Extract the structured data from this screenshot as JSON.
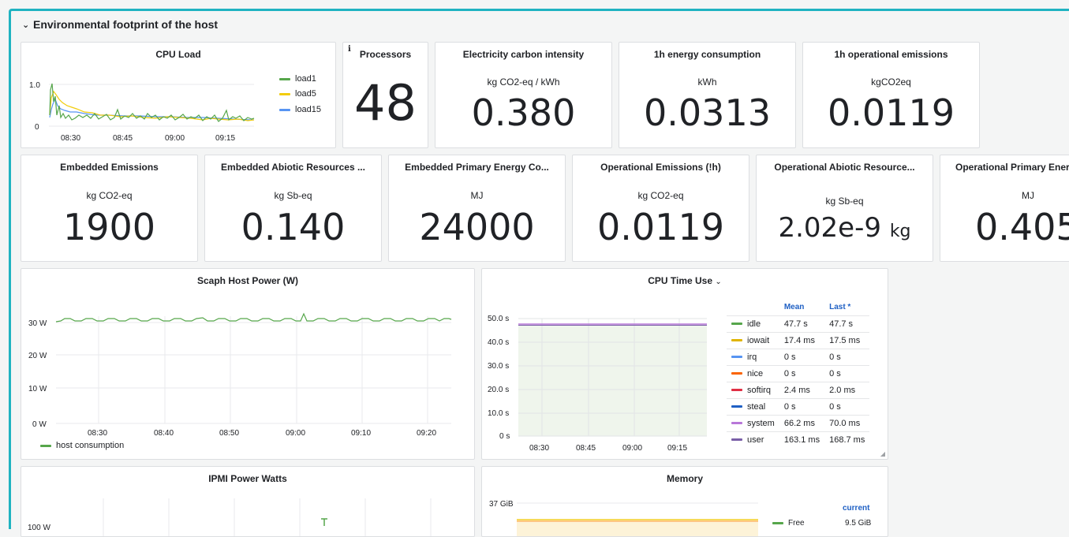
{
  "row": {
    "title": "Environmental footprint of the host"
  },
  "cpu_load": {
    "title": "CPU Load",
    "y_ticks": [
      "1.0",
      "0"
    ],
    "x_ticks": [
      "08:30",
      "08:45",
      "09:00",
      "09:15"
    ],
    "legend": [
      {
        "label": "load1",
        "color": "#56a64b"
      },
      {
        "label": "load5",
        "color": "#f2cc0c"
      },
      {
        "label": "load15",
        "color": "#5794f2"
      }
    ]
  },
  "processors": {
    "title": "Processors",
    "value": "48",
    "info": "i"
  },
  "carbon_intensity": {
    "title": "Electricity carbon intensity",
    "unit": "kg CO2-eq / kWh",
    "value": "0.380"
  },
  "energy_1h": {
    "title": "1h energy consumption",
    "unit": "kWh",
    "value": "0.0313"
  },
  "emissions_1h": {
    "title": "1h operational emissions",
    "unit": "kgCO2eq",
    "value": "0.0119"
  },
  "stats_row2": [
    {
      "title": "Embedded Emissions",
      "unit": "kg CO2-eq",
      "value": "1900",
      "suffix": ""
    },
    {
      "title": "Embedded Abiotic Resources ...",
      "unit": "kg Sb-eq",
      "value": "0.140",
      "suffix": ""
    },
    {
      "title": "Embedded Primary Energy Co...",
      "unit": "MJ",
      "value": "24000",
      "suffix": ""
    },
    {
      "title": "Operational Emissions (!h)",
      "unit": "kg CO2-eq",
      "value": "0.0119",
      "suffix": ""
    },
    {
      "title": "Operational Abiotic Resource...",
      "unit": "kg Sb-eq",
      "value": "2.02e-9",
      "suffix": "kg"
    },
    {
      "title": "Operational Primary Ener",
      "unit": "MJ",
      "value": "0.405",
      "suffix": ""
    }
  ],
  "host_power": {
    "title": "Scaph Host Power (W)",
    "y_ticks": [
      "30 W",
      "20 W",
      "10 W",
      "0 W"
    ],
    "x_ticks": [
      "08:30",
      "08:40",
      "08:50",
      "09:00",
      "09:10",
      "09:20"
    ],
    "legend": [
      {
        "label": "host consumption",
        "color": "#56a64b"
      }
    ]
  },
  "cpu_time": {
    "title": "CPU Time Use",
    "y_ticks": [
      "50.0 s",
      "40.0 s",
      "30.0 s",
      "20.0 s",
      "10.0 s",
      "0 s"
    ],
    "x_ticks": [
      "08:30",
      "08:45",
      "09:00",
      "09:15"
    ],
    "columns": [
      "Mean",
      "Last *"
    ],
    "rows": [
      {
        "name": "idle",
        "color": "#56a64b",
        "mean": "47.7 s",
        "last": "47.7 s"
      },
      {
        "name": "iowait",
        "color": "#e0b400",
        "mean": "17.4 ms",
        "last": "17.5 ms"
      },
      {
        "name": "irq",
        "color": "#5794f2",
        "mean": "0 s",
        "last": "0 s"
      },
      {
        "name": "nice",
        "color": "#fa6400",
        "mean": "0 s",
        "last": "0 s"
      },
      {
        "name": "softirq",
        "color": "#e02f44",
        "mean": "2.4 ms",
        "last": "2.0 ms"
      },
      {
        "name": "steal",
        "color": "#1f60c4",
        "mean": "0 s",
        "last": "0 s"
      },
      {
        "name": "system",
        "color": "#b877d9",
        "mean": "66.2 ms",
        "last": "70.0 ms"
      },
      {
        "name": "user",
        "color": "#7a5fa8",
        "mean": "163.1 ms",
        "last": "168.7 ms"
      }
    ]
  },
  "ipmi": {
    "title": "IPMI Power Watts",
    "y_tick": "100 W"
  },
  "memory": {
    "title": "Memory",
    "y_tick": "37 GiB",
    "column": "current",
    "legend": [
      {
        "name": "Free",
        "color": "#56a64b",
        "value": "9.5 GiB"
      }
    ]
  }
}
